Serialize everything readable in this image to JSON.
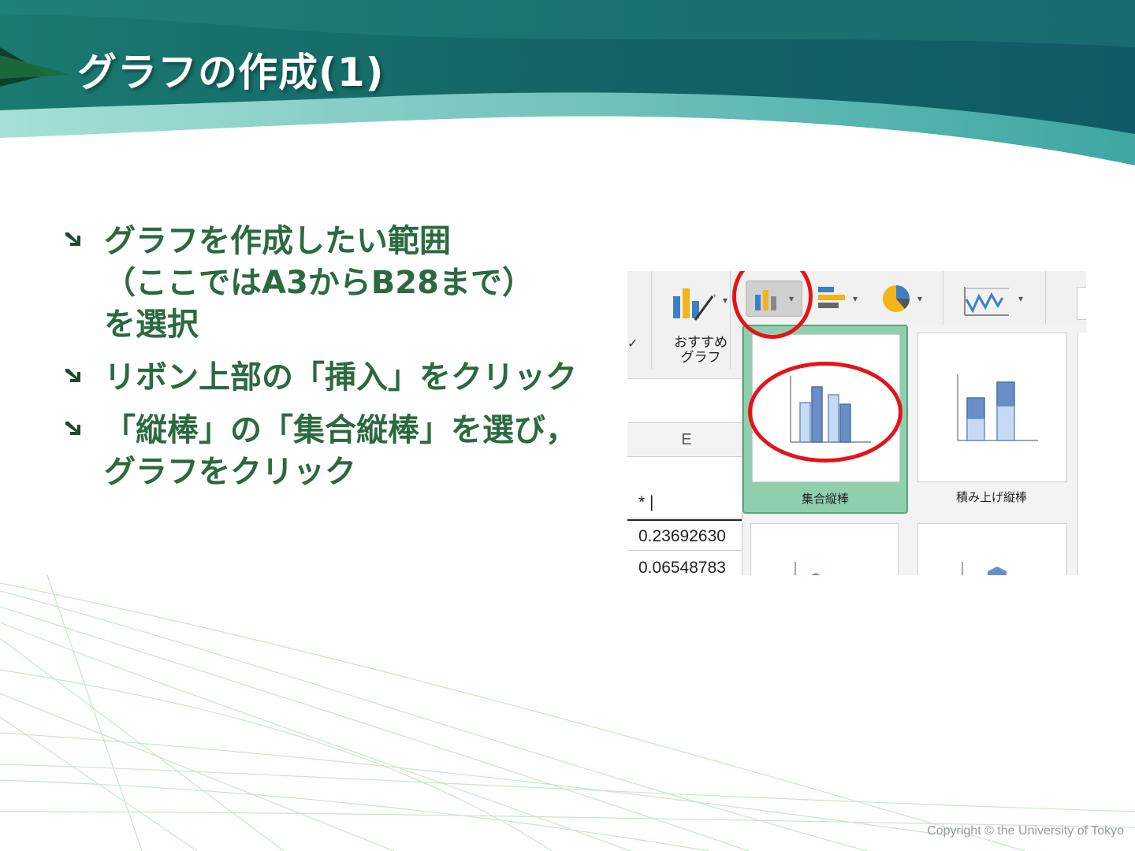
{
  "slide": {
    "title": "グラフの作成(1)",
    "bullets": [
      {
        "lines": [
          "グラフを作成したい範囲",
          "（ここではA3からB28まで）",
          "を選択"
        ]
      },
      {
        "lines": [
          "リボン上部の「挿入」をクリック"
        ]
      },
      {
        "lines": [
          "「縦棒」の「集合縦棒」を選び，",
          "グラフをクリック"
        ]
      }
    ],
    "copyright": "Copyright © the University of Tokyo"
  },
  "screenshot": {
    "recommended_label_line1": "おすすめ",
    "recommended_label_line2": "グラフ",
    "column_header": "E",
    "cell_header": "* |",
    "cell_values": [
      "0.23692630",
      "0.06548783"
    ],
    "chart_options": [
      {
        "label": "集合縦棒",
        "selected": true
      },
      {
        "label": "積み上げ縦棒",
        "selected": false
      }
    ],
    "icons": [
      "recommended-charts-icon",
      "column-chart-icon",
      "bar-chart-icon",
      "pie-chart-icon",
      "line-chart-icon"
    ]
  },
  "colors": {
    "title_text": "#ffffff",
    "bullet_text": "#2b6a3f",
    "banner_dark": "#146867",
    "banner_light": "#8fd3cb",
    "highlight_red": "#e4141b",
    "bar_fill_light": "#c5dbf3",
    "bar_fill_dark": "#6a8fc6"
  }
}
